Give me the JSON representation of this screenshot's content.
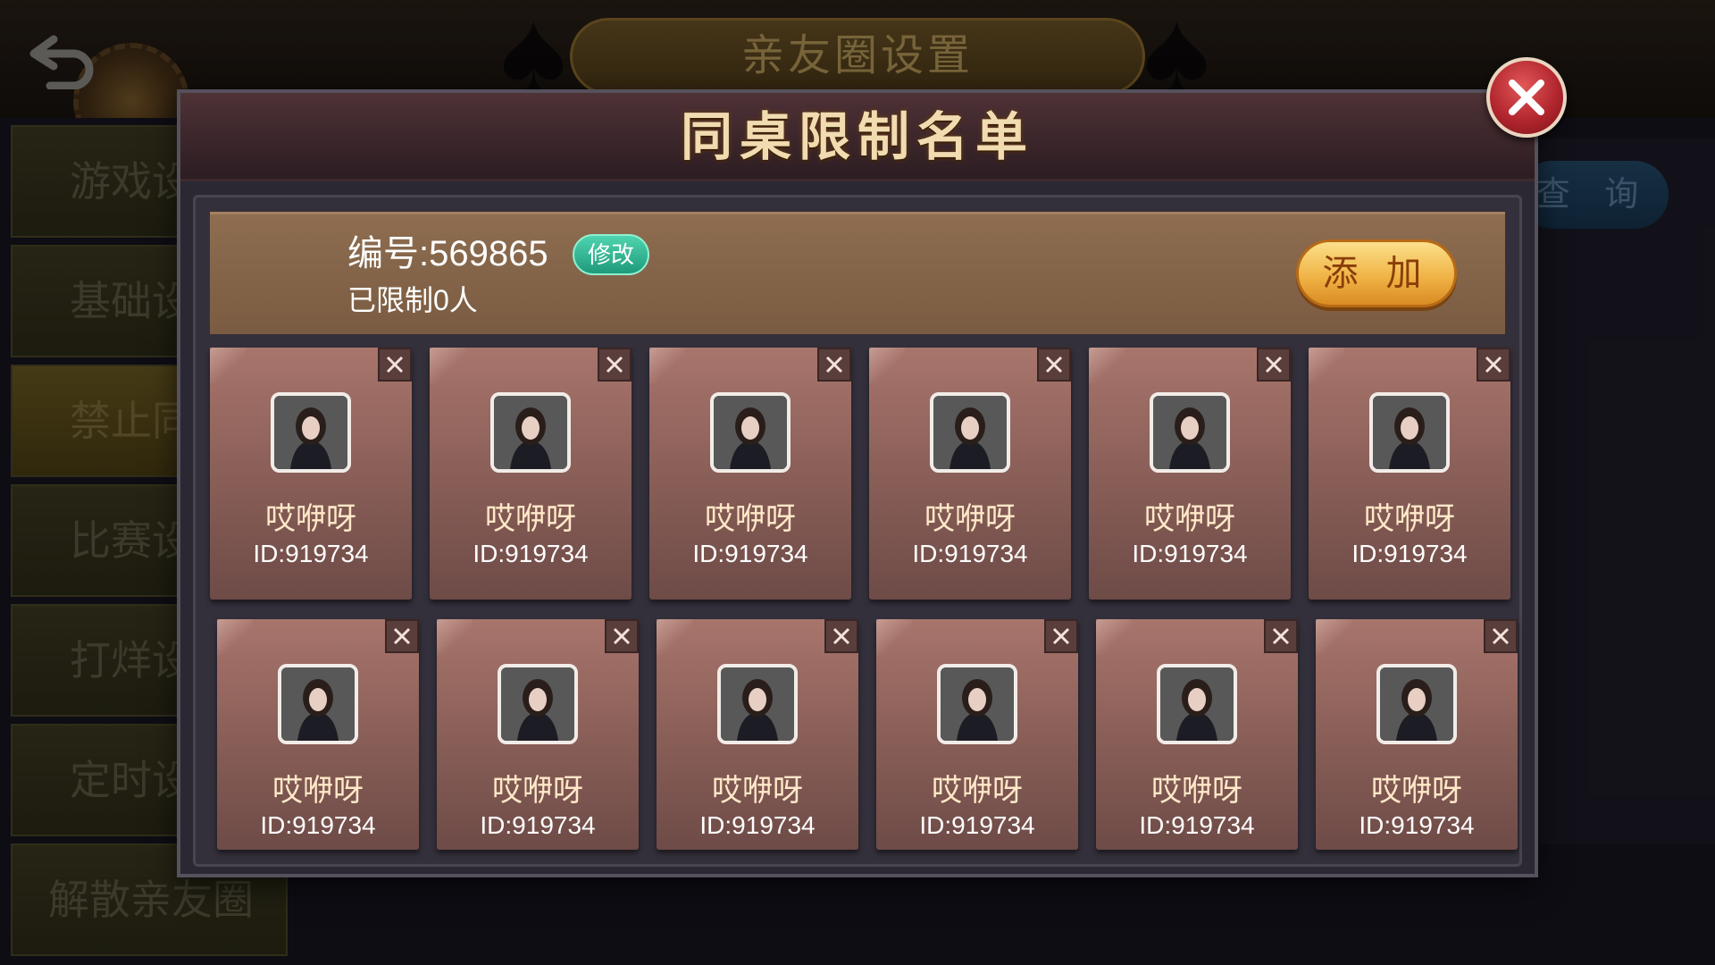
{
  "background": {
    "top_title": "亲友圈设置",
    "query_label": "查 询",
    "sidebar": [
      {
        "label": "游戏设置"
      },
      {
        "label": "基础设置"
      },
      {
        "label": "禁止同桌"
      },
      {
        "label": "比赛设置"
      },
      {
        "label": "打烊设置"
      },
      {
        "label": "定时设置"
      },
      {
        "label": "解散亲友圈"
      }
    ]
  },
  "modal": {
    "title": "同桌限制名单",
    "number_label": "编号:569865",
    "edit_label": "修改",
    "limit_count": "已限制0人",
    "add_label": "添 加",
    "members": [
      {
        "name": "哎咿呀",
        "id": "ID:919734"
      },
      {
        "name": "哎咿呀",
        "id": "ID:919734"
      },
      {
        "name": "哎咿呀",
        "id": "ID:919734"
      },
      {
        "name": "哎咿呀",
        "id": "ID:919734"
      },
      {
        "name": "哎咿呀",
        "id": "ID:919734"
      },
      {
        "name": "哎咿呀",
        "id": "ID:919734"
      },
      {
        "name": "哎咿呀",
        "id": "ID:919734"
      },
      {
        "name": "哎咿呀",
        "id": "ID:919734"
      },
      {
        "name": "哎咿呀",
        "id": "ID:919734"
      },
      {
        "name": "哎咿呀",
        "id": "ID:919734"
      },
      {
        "name": "哎咿呀",
        "id": "ID:919734"
      },
      {
        "name": "哎咿呀",
        "id": "ID:919734"
      }
    ]
  },
  "colors": {
    "title_gold": "#f0dcb0",
    "card_top": "#a8756c",
    "add_button": "#f0b447",
    "edit_button": "#1f9a7a",
    "close_button": "#b2262e"
  }
}
